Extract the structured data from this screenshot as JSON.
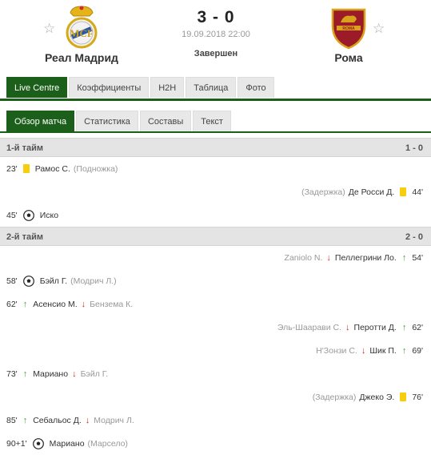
{
  "match": {
    "home_team": "Реал Мадрид",
    "away_team": "Рома",
    "score": "3 - 0",
    "datetime": "19.09.2018 22:00",
    "status": "Завершен"
  },
  "icons": {
    "star": "☆",
    "yellow_card_color": "#f7cd0c",
    "sub_in_color": "#3ba536",
    "sub_out_color": "#c8282d",
    "accent_color": "#1b5f1b"
  },
  "main_tabs": [
    "Live Centre",
    "Коэффициенты",
    "H2H",
    "Таблица",
    "Фото"
  ],
  "sub_tabs": [
    "Обзор матча",
    "Статистика",
    "Составы",
    "Текст"
  ],
  "periods": [
    {
      "name": "1-й тайм",
      "score": "1 - 0",
      "events": [
        {
          "side": "home",
          "minute": "23'",
          "type": "yellow",
          "player": "Рамос С.",
          "note": "(Подножка)"
        },
        {
          "side": "away",
          "minute": "44'",
          "type": "yellow",
          "player": "Де Росси Д.",
          "note": "(Задержка)"
        },
        {
          "side": "home",
          "minute": "45'",
          "type": "goal",
          "player": "Иско",
          "note": ""
        }
      ]
    },
    {
      "name": "2-й тайм",
      "score": "2 - 0",
      "events": [
        {
          "side": "away",
          "minute": "54'",
          "type": "sub",
          "player_in": "Пеллегрини Ло.",
          "player_out": "Zaniolo N."
        },
        {
          "side": "home",
          "minute": "58'",
          "type": "goal",
          "player": "Бэйл Г.",
          "note": "(Модрич Л.)"
        },
        {
          "side": "home",
          "minute": "62'",
          "type": "sub",
          "player_in": "Асенсио М.",
          "player_out": "Бензема К."
        },
        {
          "side": "away",
          "minute": "62'",
          "type": "sub",
          "player_in": "Перотти Д.",
          "player_out": "Эль-Шаарави С."
        },
        {
          "side": "away",
          "minute": "69'",
          "type": "sub",
          "player_in": "Шик П.",
          "player_out": "Н'Зонзи С."
        },
        {
          "side": "home",
          "minute": "73'",
          "type": "sub",
          "player_in": "Мариано",
          "player_out": "Бэйл Г."
        },
        {
          "side": "away",
          "minute": "76'",
          "type": "yellow",
          "player": "Джеко Э.",
          "note": "(Задержка)"
        },
        {
          "side": "home",
          "minute": "85'",
          "type": "sub",
          "player_in": "Себальос Д.",
          "player_out": "Модрич Л."
        },
        {
          "side": "home",
          "minute": "90+1'",
          "type": "goal",
          "player": "Мариано",
          "note": "(Марсело)"
        }
      ]
    }
  ]
}
